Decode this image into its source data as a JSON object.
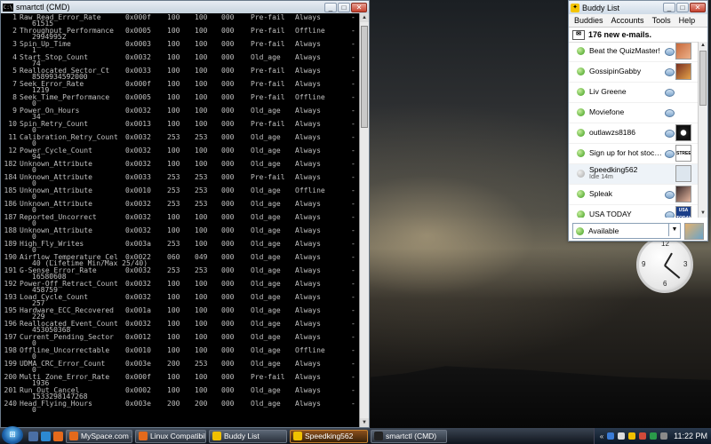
{
  "cmd": {
    "title": "smartctl (CMD)",
    "rows": [
      {
        "id": "1",
        "name": "Raw_Read_Error_Rate",
        "flag": "0x000f",
        "value": "100",
        "worst": "100",
        "thresh": "000",
        "type": "Pre-fail",
        "updated": "Always",
        "raw": "61515"
      },
      {
        "id": "2",
        "name": "Throughput_Performance",
        "flag": "0x0005",
        "value": "100",
        "worst": "100",
        "thresh": "000",
        "type": "Pre-fail",
        "updated": "Offline",
        "raw": "29949952"
      },
      {
        "id": "3",
        "name": "Spin_Up_Time",
        "flag": "0x0003",
        "value": "100",
        "worst": "100",
        "thresh": "000",
        "type": "Pre-fail",
        "updated": "Always",
        "raw": "1"
      },
      {
        "id": "4",
        "name": "Start_Stop_Count",
        "flag": "0x0032",
        "value": "100",
        "worst": "100",
        "thresh": "000",
        "type": "Old_age",
        "updated": "Always",
        "raw": "74"
      },
      {
        "id": "5",
        "name": "Reallocated_Sector_Ct",
        "flag": "0x0033",
        "value": "100",
        "worst": "100",
        "thresh": "000",
        "type": "Pre-fail",
        "updated": "Always",
        "raw": "8589934592000"
      },
      {
        "id": "7",
        "name": "Seek_Error_Rate",
        "flag": "0x000f",
        "value": "100",
        "worst": "100",
        "thresh": "000",
        "type": "Pre-fail",
        "updated": "Always",
        "raw": "1219"
      },
      {
        "id": "8",
        "name": "Seek_Time_Performance",
        "flag": "0x0005",
        "value": "100",
        "worst": "100",
        "thresh": "000",
        "type": "Pre-fail",
        "updated": "Offline",
        "raw": "0"
      },
      {
        "id": "9",
        "name": "Power_On_Hours",
        "flag": "0x0032",
        "value": "100",
        "worst": "100",
        "thresh": "000",
        "type": "Old_age",
        "updated": "Always",
        "raw": "34"
      },
      {
        "id": "10",
        "name": "Spin_Retry_Count",
        "flag": "0x0013",
        "value": "100",
        "worst": "100",
        "thresh": "000",
        "type": "Pre-fail",
        "updated": "Always",
        "raw": "0"
      },
      {
        "id": "11",
        "name": "Calibration_Retry_Count",
        "flag": "0x0032",
        "value": "253",
        "worst": "253",
        "thresh": "000",
        "type": "Old_age",
        "updated": "Always",
        "raw": "0"
      },
      {
        "id": "12",
        "name": "Power_Cycle_Count",
        "flag": "0x0032",
        "value": "100",
        "worst": "100",
        "thresh": "000",
        "type": "Old_age",
        "updated": "Always",
        "raw": "94"
      },
      {
        "id": "182",
        "name": "Unknown_Attribute",
        "flag": "0x0032",
        "value": "100",
        "worst": "100",
        "thresh": "000",
        "type": "Old_age",
        "updated": "Always",
        "raw": "0"
      },
      {
        "id": "184",
        "name": "Unknown_Attribute",
        "flag": "0x0033",
        "value": "253",
        "worst": "253",
        "thresh": "000",
        "type": "Pre-fail",
        "updated": "Always",
        "raw": "0"
      },
      {
        "id": "185",
        "name": "Unknown_Attribute",
        "flag": "0x0010",
        "value": "253",
        "worst": "253",
        "thresh": "000",
        "type": "Old_age",
        "updated": "Offline",
        "raw": "0"
      },
      {
        "id": "186",
        "name": "Unknown_Attribute",
        "flag": "0x0032",
        "value": "253",
        "worst": "253",
        "thresh": "000",
        "type": "Old_age",
        "updated": "Always",
        "raw": "0"
      },
      {
        "id": "187",
        "name": "Reported_Uncorrect",
        "flag": "0x0032",
        "value": "100",
        "worst": "100",
        "thresh": "000",
        "type": "Old_age",
        "updated": "Always",
        "raw": "0"
      },
      {
        "id": "188",
        "name": "Unknown_Attribute",
        "flag": "0x0032",
        "value": "100",
        "worst": "100",
        "thresh": "000",
        "type": "Old_age",
        "updated": "Always",
        "raw": "0"
      },
      {
        "id": "189",
        "name": "High_Fly_Writes",
        "flag": "0x003a",
        "value": "253",
        "worst": "100",
        "thresh": "000",
        "type": "Old_age",
        "updated": "Always",
        "raw": "0"
      },
      {
        "id": "190",
        "name": "Airflow_Temperature_Cel",
        "flag": "0x0022",
        "value": "060",
        "worst": "049",
        "thresh": "000",
        "type": "Old_age",
        "updated": "Always",
        "raw": "40 (Lifetime Min/Max 25/40)"
      },
      {
        "id": "191",
        "name": "G-Sense_Error_Rate",
        "flag": "0x0032",
        "value": "253",
        "worst": "253",
        "thresh": "000",
        "type": "Old_age",
        "updated": "Always",
        "raw": "16580608"
      },
      {
        "id": "192",
        "name": "Power-Off_Retract_Count",
        "flag": "0x0032",
        "value": "100",
        "worst": "100",
        "thresh": "000",
        "type": "Old_age",
        "updated": "Always",
        "raw": "458759"
      },
      {
        "id": "193",
        "name": "Load_Cycle_Count",
        "flag": "0x0032",
        "value": "100",
        "worst": "100",
        "thresh": "000",
        "type": "Old_age",
        "updated": "Always",
        "raw": "257"
      },
      {
        "id": "195",
        "name": "Hardware_ECC_Recovered",
        "flag": "0x001a",
        "value": "100",
        "worst": "100",
        "thresh": "000",
        "type": "Old_age",
        "updated": "Always",
        "raw": "229"
      },
      {
        "id": "196",
        "name": "Reallocated_Event_Count",
        "flag": "0x0032",
        "value": "100",
        "worst": "100",
        "thresh": "000",
        "type": "Old_age",
        "updated": "Always",
        "raw": "453050368"
      },
      {
        "id": "197",
        "name": "Current_Pending_Sector",
        "flag": "0x0012",
        "value": "100",
        "worst": "100",
        "thresh": "000",
        "type": "Old_age",
        "updated": "Always",
        "raw": "0"
      },
      {
        "id": "198",
        "name": "Offline_Uncorrectable",
        "flag": "0x0010",
        "value": "100",
        "worst": "100",
        "thresh": "000",
        "type": "Old_age",
        "updated": "Offline",
        "raw": "0"
      },
      {
        "id": "199",
        "name": "UDMA_CRC_Error_Count",
        "flag": "0x003e",
        "value": "200",
        "worst": "253",
        "thresh": "000",
        "type": "Old_age",
        "updated": "Always",
        "raw": "0"
      },
      {
        "id": "200",
        "name": "Multi_Zone_Error_Rate",
        "flag": "0x000f",
        "value": "100",
        "worst": "100",
        "thresh": "000",
        "type": "Pre-fail",
        "updated": "Always",
        "raw": "1936"
      },
      {
        "id": "201",
        "name": "Run_Out_Cancel",
        "flag": "0x0002",
        "value": "100",
        "worst": "100",
        "thresh": "000",
        "type": "Old_age",
        "updated": "Always",
        "raw": "1533298147268"
      },
      {
        "id": "240",
        "name": "Head_Flying_Hours",
        "flag": "0x003e",
        "value": "200",
        "worst": "200",
        "thresh": "000",
        "type": "Old_age",
        "updated": "Always",
        "raw": "0"
      }
    ]
  },
  "buddy": {
    "title": "Buddy List",
    "menu": [
      "Buddies",
      "Accounts",
      "Tools",
      "Help"
    ],
    "mail": "176 new e-mails.",
    "buddies": [
      {
        "name": "Beat the QuizMaster!",
        "sub": "",
        "status": "online",
        "avatar": "quiz",
        "avatar_text": ""
      },
      {
        "name": "GossipinGabby",
        "sub": "",
        "status": "online",
        "avatar": "gabby",
        "avatar_text": ""
      },
      {
        "name": "Liv Greene",
        "sub": "",
        "status": "online",
        "avatar": "",
        "avatar_text": ""
      },
      {
        "name": "Moviefone",
        "sub": "",
        "status": "online",
        "avatar": "",
        "avatar_text": ""
      },
      {
        "name": "outlawzs8186",
        "sub": "",
        "status": "online",
        "avatar": "outlaw",
        "avatar_text": ""
      },
      {
        "name": "Sign up for hot stock a...",
        "sub": "",
        "status": "online",
        "avatar": "street",
        "avatar_text": "STREET"
      },
      {
        "name": "Speedking562",
        "sub": "Idle 14m",
        "status": "idle",
        "avatar": "speed",
        "avatar_text": ""
      },
      {
        "name": "Spleak",
        "sub": "",
        "status": "online",
        "avatar": "spleak",
        "avatar_text": ""
      },
      {
        "name": "USA TODAY",
        "sub": "",
        "status": "online",
        "avatar": "usa",
        "avatar_text": "USA TODAY"
      }
    ],
    "status": "Available"
  },
  "clock_numbers": [
    "12",
    "3",
    "6",
    "9"
  ],
  "taskbar": {
    "tasks": [
      {
        "label": "MySpace.com -",
        "icon_color": "#e46a1c",
        "active": false,
        "width": 75
      },
      {
        "label": "Linux Compatibili...",
        "icon_color": "#e46a1c",
        "active": false,
        "width": 80
      },
      {
        "label": "Buddy List",
        "icon_color": "#f0c000",
        "active": false,
        "width": 88
      },
      {
        "label": "Speedking562",
        "icon_color": "#f0c000",
        "active": true,
        "width": 88
      },
      {
        "label": "smartctl (CMD)",
        "icon_color": "#222222",
        "active": false,
        "width": 86
      }
    ],
    "time": "11:22 PM"
  },
  "colors": {
    "accent": "#1a5fa8",
    "online": "#3a9a1a",
    "idle": "#a9a9a9"
  }
}
